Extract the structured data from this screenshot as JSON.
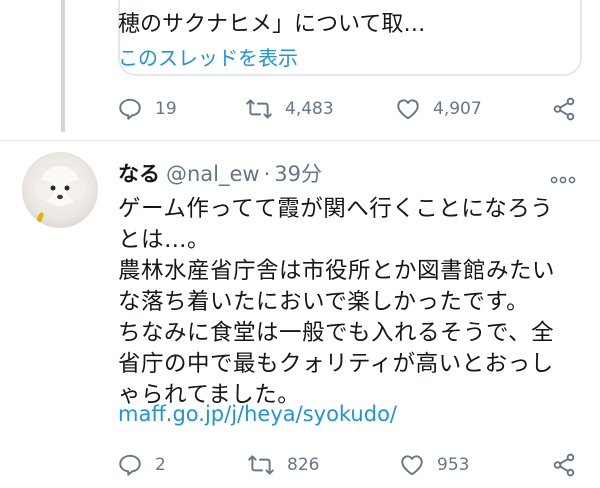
{
  "quoted": {
    "text_line": "穂のサクナヒメ」について取…",
    "show_thread": "このスレッドを表示",
    "replies": "19",
    "retweets": "4,483",
    "likes": "4,907"
  },
  "tweet": {
    "name": "なる",
    "handle": "@nal_ew",
    "separator": "·",
    "time": "39分",
    "lines": [
      "ゲーム作ってて霞が関へ行くことになろう",
      "とは…。",
      "農林水産省庁舎は市役所とか図書館みたい",
      "な落ち着いたにおいで楽しかったです。",
      "ちなみに食堂は一般でも入れるそうで、全",
      "省庁の中で最もクォリティが高いとおっし",
      "ゃられてました。"
    ],
    "link": "maff.go.jp/j/heya/syokudo/",
    "replies": "2",
    "retweets": "826",
    "likes": "953"
  },
  "icons": {
    "reply": "reply-icon",
    "retweet": "retweet-icon",
    "like": "heart-icon",
    "share": "share-icon",
    "more": "more-icon"
  },
  "colors": {
    "link": "#1b95e0",
    "muted": "#657786",
    "thread_line": "#ccd6dd"
  }
}
